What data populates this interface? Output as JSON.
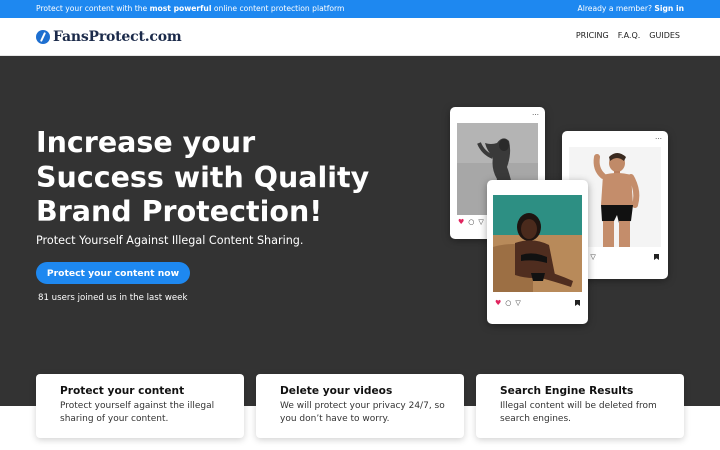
{
  "topbar": {
    "pre": "Protect your content with the ",
    "strong": "most powerful",
    "post": " online content protection platform",
    "member_text": "Already a member? ",
    "signin_label": "Sign in"
  },
  "nav": {
    "logo_text": "FansProtect.com",
    "links": [
      "PRICING",
      "F.A.Q.",
      "GUIDES"
    ]
  },
  "hero": {
    "headline_lines": [
      "Increase your",
      "Success with Quality",
      "Brand Protection!"
    ],
    "subline": "Protect Yourself Against Illegal Content Sharing.",
    "cta_label": "Protect your content now",
    "joined_text": "81 users joined us in the last week"
  },
  "cards": {
    "more_glyph": "…",
    "heart_glyph": "♥",
    "comment_glyph": "○",
    "share_glyph": "▽"
  },
  "features": [
    {
      "title": "Protect your content",
      "text": "Protect yourself against the illegal sharing of your content."
    },
    {
      "title": "Delete your videos",
      "text": "We will protect your privacy 24/7, so you don’t have to worry."
    },
    {
      "title": "Search Engine Results",
      "text": "Illegal content will be deleted from search engines."
    }
  ],
  "colors": {
    "accent": "#1e88f0",
    "hero_bg": "#333333",
    "logo": "#1b2a4a"
  }
}
